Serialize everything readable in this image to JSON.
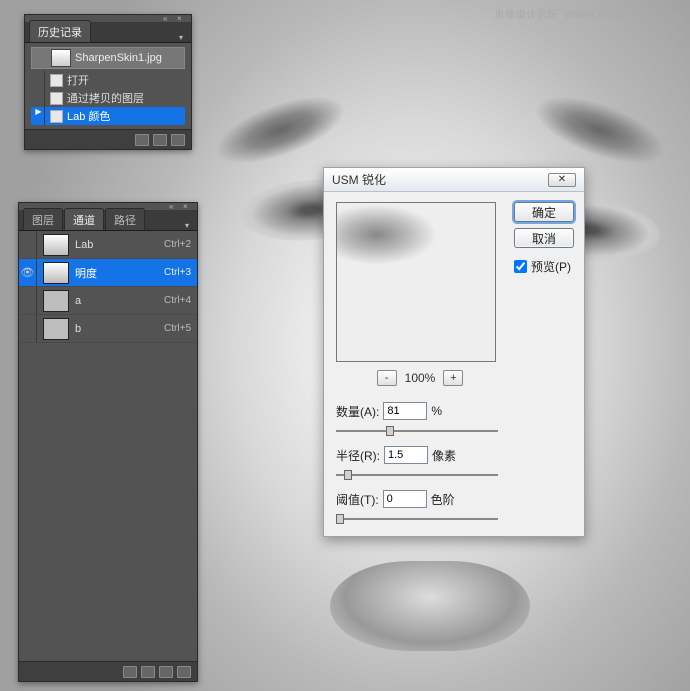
{
  "watermark": {
    "text": "思缘设计论坛",
    "url": "WWW.MISSYUAN.COM"
  },
  "history_panel": {
    "title": "历史记录",
    "snapshot": "SharpenSkin1.jpg",
    "items": [
      {
        "label": "打开",
        "selected": false
      },
      {
        "label": "通过拷贝的图层",
        "selected": false
      },
      {
        "label": "Lab 颜色",
        "selected": true
      }
    ]
  },
  "channels_panel": {
    "tabs": [
      "图层",
      "通道",
      "路径"
    ],
    "active_tab_index": 1,
    "rows": [
      {
        "name": "Lab",
        "shortcut": "Ctrl+2",
        "selected": false,
        "visible": false
      },
      {
        "name": "明度",
        "shortcut": "Ctrl+3",
        "selected": true,
        "visible": true
      },
      {
        "name": "a",
        "shortcut": "Ctrl+4",
        "selected": false,
        "visible": false
      },
      {
        "name": "b",
        "shortcut": "Ctrl+5",
        "selected": false,
        "visible": false
      }
    ]
  },
  "usm_dialog": {
    "title": "USM 锐化",
    "ok": "确定",
    "cancel": "取消",
    "preview_label": "预览(P)",
    "preview_checked": true,
    "zoom": "100%",
    "params": {
      "amount_label": "数量(A):",
      "amount_value": "81",
      "amount_unit": "%",
      "radius_label": "半径(R):",
      "radius_value": "1.5",
      "radius_unit": "像素",
      "threshold_label": "阈值(T):",
      "threshold_value": "0",
      "threshold_unit": "色阶"
    },
    "slider_positions": {
      "amount_pct": 30,
      "radius_pct": 5,
      "threshold_pct": 0
    }
  }
}
